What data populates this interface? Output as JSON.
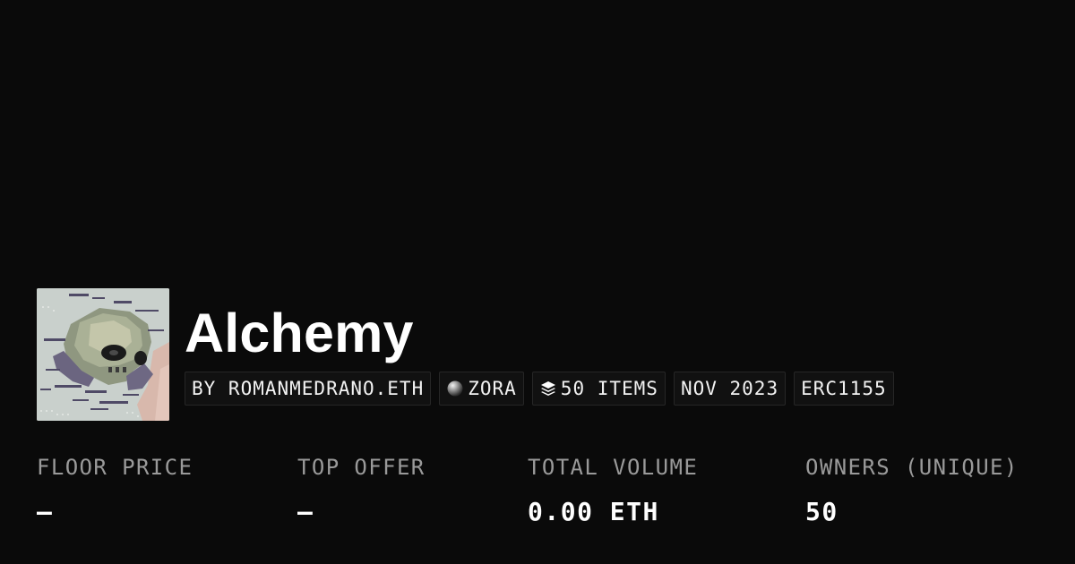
{
  "collection": {
    "name": "Alchemy",
    "thumbnail_alt": "Alchemy collection artwork"
  },
  "chips": {
    "creator": "BY ROMANMEDRANO.ETH",
    "chain": "ZORA",
    "chain_icon": "zora-orb-icon",
    "items": "50 ITEMS",
    "items_icon": "layers-icon",
    "date": "NOV 2023",
    "standard": "ERC1155"
  },
  "stats": {
    "floor_price": {
      "label": "FLOOR PRICE",
      "value": "–"
    },
    "top_offer": {
      "label": "TOP OFFER",
      "value": "–"
    },
    "total_volume": {
      "label": "TOTAL VOLUME",
      "value": "0.00 ETH"
    },
    "owners": {
      "label": "OWNERS (UNIQUE)",
      "value": "50"
    }
  },
  "colors": {
    "background": "#0a0a0a",
    "text_primary": "#ffffff",
    "text_secondary": "#9a9a9a",
    "chip_background": "#111111",
    "chip_border": "#262626"
  }
}
